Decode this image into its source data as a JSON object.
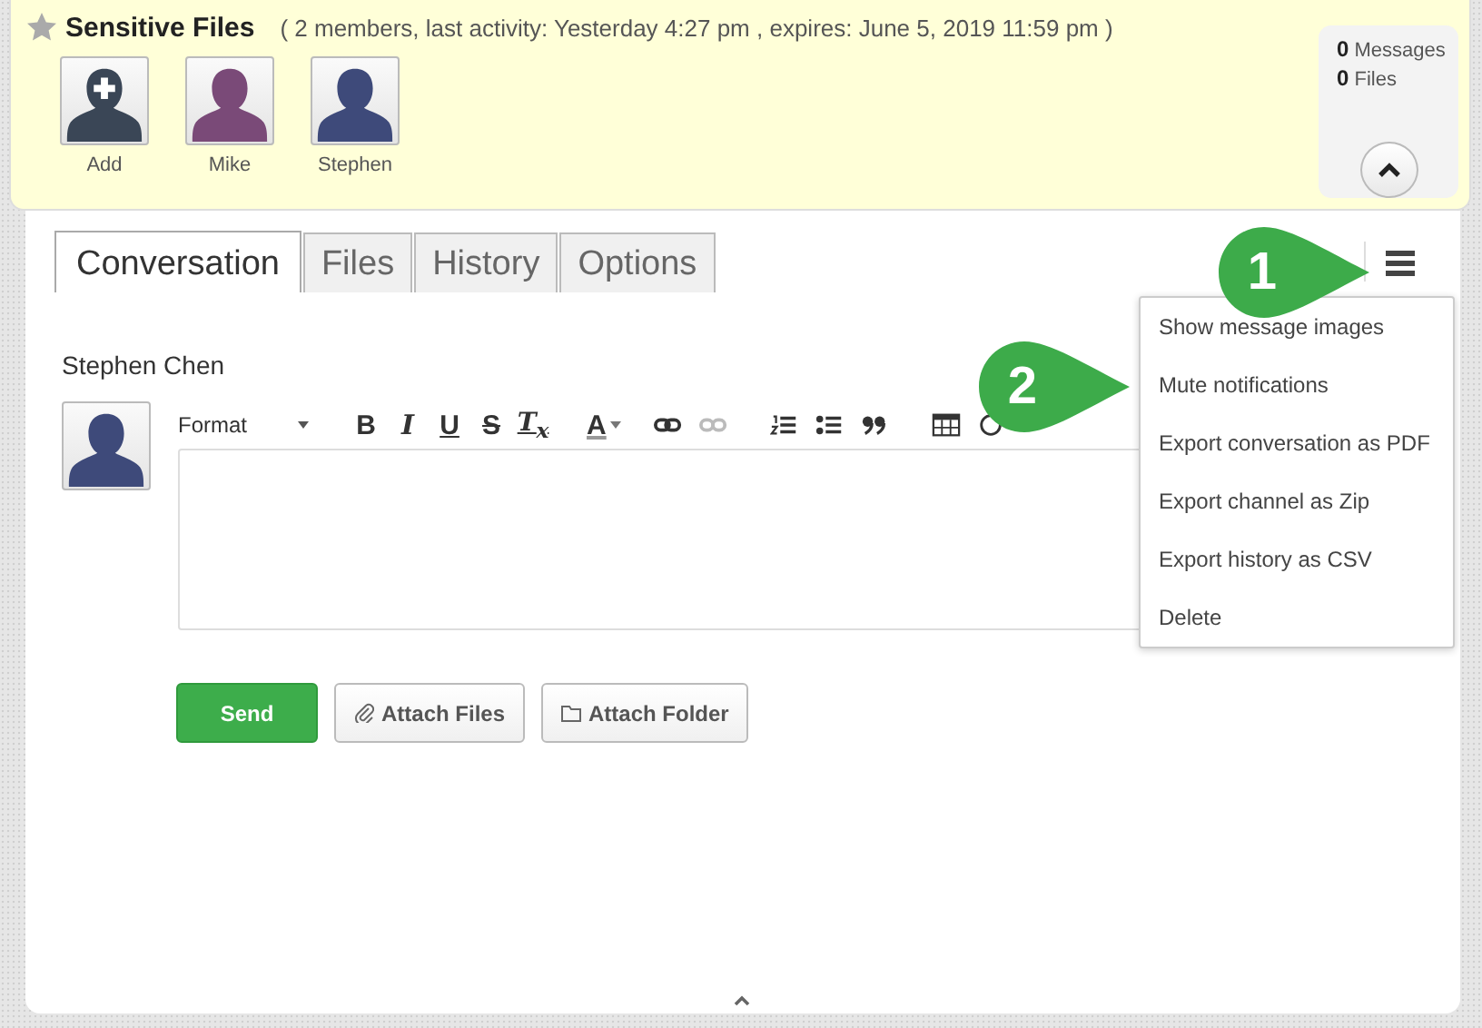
{
  "header": {
    "starred": false,
    "title": "Sensitive Files",
    "details": "( 2 members, last activity: Yesterday 4:27 pm , expires: June 5, 2019 11:59 pm )",
    "members": [
      {
        "kind": "add",
        "name": "Add",
        "color": "#3a4656"
      },
      {
        "kind": "person",
        "name": "Mike",
        "color": "#7a4a78"
      },
      {
        "kind": "person",
        "name": "Stephen",
        "color": "#3e4a7a"
      }
    ],
    "stats": [
      {
        "count": "0",
        "label": "Messages"
      },
      {
        "count": "0",
        "label": "Files"
      }
    ]
  },
  "tabs": [
    {
      "label": "Conversation",
      "selected": true
    },
    {
      "label": "Files",
      "selected": false
    },
    {
      "label": "History",
      "selected": false
    },
    {
      "label": "Options",
      "selected": false
    }
  ],
  "composer": {
    "author": "Stephen Chen",
    "format_label": "Format",
    "text_buttons": [
      "B",
      "I",
      "U",
      "S",
      "T$_{x}$"
    ],
    "color_button": "A",
    "actions": [
      {
        "kind": "primary",
        "label": "Send"
      },
      {
        "kind": "files",
        "label": "Attach Files"
      },
      {
        "kind": "folder",
        "label": "Attach Folder"
      }
    ]
  },
  "menu": {
    "open": true,
    "items": [
      "Show message images",
      "Mute notifications",
      "Export conversation as PDF",
      "Export channel as Zip",
      "Export history as CSV",
      "Delete"
    ]
  },
  "callouts": [
    {
      "number": "1"
    },
    {
      "number": "2"
    }
  ]
}
